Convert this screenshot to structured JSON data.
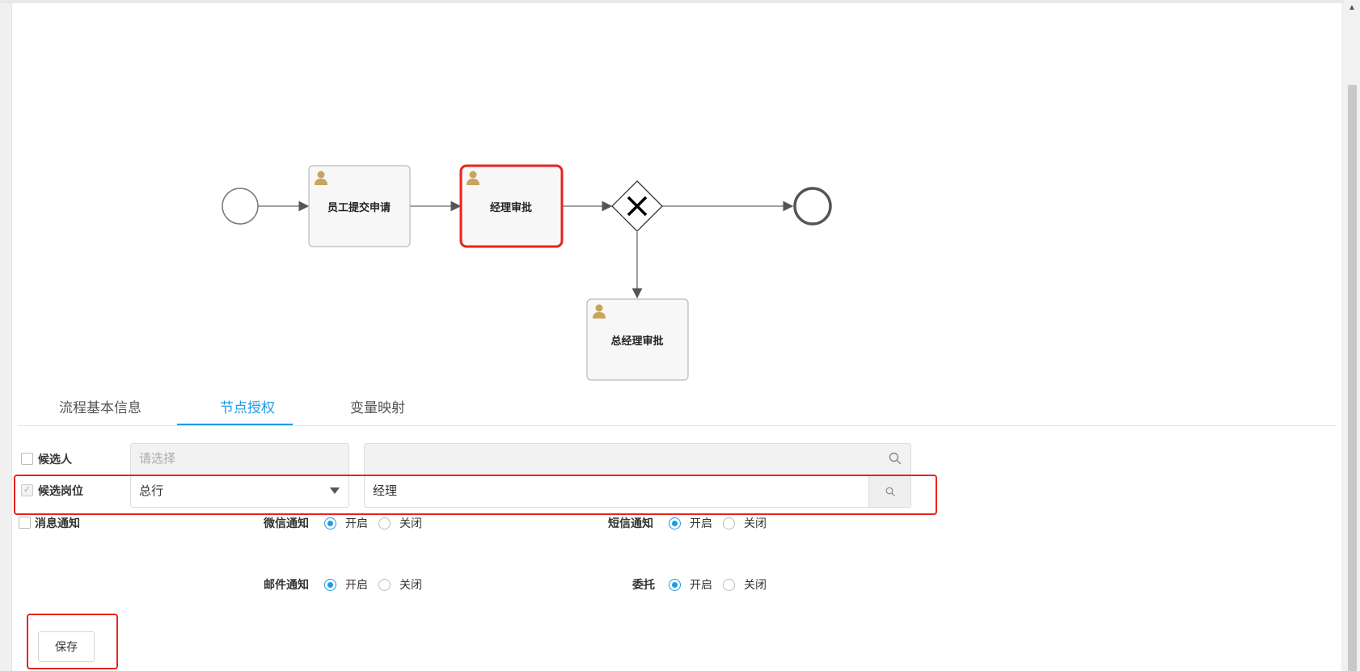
{
  "diagram": {
    "tasks": [
      {
        "id": "submit",
        "label": "员工提交申请"
      },
      {
        "id": "manager",
        "label": "经理审批"
      },
      {
        "id": "gm",
        "label": "总经理审批"
      }
    ]
  },
  "tabs": [
    {
      "label": "流程基本信息",
      "active": false
    },
    {
      "label": "节点授权",
      "active": true
    },
    {
      "label": "变量映射",
      "active": false
    }
  ],
  "form": {
    "candidate_user": {
      "label": "候选人",
      "checked": false,
      "placeholder": "请选择",
      "search_value": ""
    },
    "candidate_post": {
      "label": "候选岗位",
      "checked": true,
      "select_value": "总行",
      "search_value": "经理"
    },
    "notify": {
      "label": "消息通知",
      "checked": false,
      "wechat": {
        "label": "微信通知",
        "on": "开启",
        "off": "关闭",
        "value": "开启"
      },
      "sms": {
        "label": "短信通知",
        "on": "开启",
        "off": "关闭",
        "value": "开启"
      },
      "email": {
        "label": "邮件通知",
        "on": "开启",
        "off": "关闭",
        "value": "开启"
      },
      "delegate": {
        "label": "委托",
        "on": "开启",
        "off": "关闭",
        "value": "开启"
      }
    }
  },
  "save_label": "保存",
  "colors": {
    "accent": "#1e9be6",
    "highlight": "#e8231f",
    "task_icon": "#c9a45c"
  }
}
